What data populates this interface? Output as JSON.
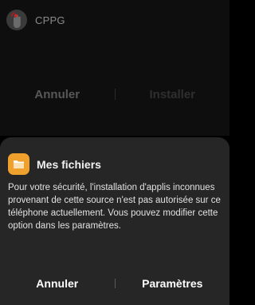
{
  "installer": {
    "app_name": "CPPG",
    "app_icon": "hand-touch-icon",
    "cancel_label": "Annuler",
    "install_label": "Installer"
  },
  "dialog": {
    "icon": "folder-icon",
    "title": "Mes fichiers",
    "message": "Pour votre sécurité, l'installation d'applis inconnues provenant de cette source n'est pas autorisée sur ce téléphone actuellement. Vous pouvez modifier cette option dans les paramètres.",
    "cancel_label": "Annuler",
    "settings_label": "Paramètres"
  },
  "colors": {
    "dialog_background": "#262626",
    "folder_icon": "#f0a02c"
  }
}
